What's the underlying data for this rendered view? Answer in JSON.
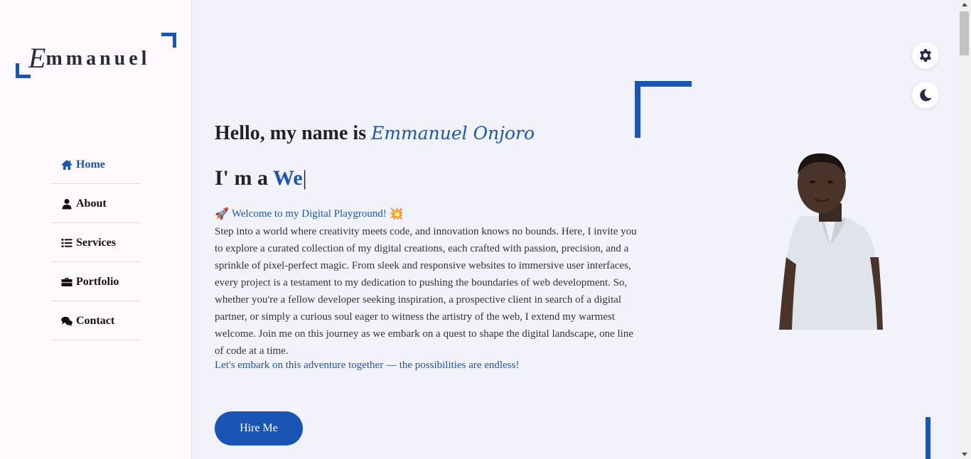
{
  "logo": {
    "first_letter": "E",
    "rest": "mmanuel"
  },
  "nav": {
    "items": [
      {
        "label": "Home",
        "icon": "home-icon",
        "active": true
      },
      {
        "label": "About",
        "icon": "user-icon",
        "active": false
      },
      {
        "label": "Services",
        "icon": "list-icon",
        "active": false
      },
      {
        "label": "Portfolio",
        "icon": "briefcase-icon",
        "active": false
      },
      {
        "label": "Contact",
        "icon": "comments-icon",
        "active": false
      }
    ]
  },
  "hero": {
    "greeting": "Hello, my name is",
    "name": "Emmanuel Onjoro",
    "role_prefix": "I' m a",
    "role_typed": "We",
    "role_cursor": "|",
    "welcome_emoji_start": "🚀",
    "welcome_text": "Welcome to my Digital Playground!",
    "welcome_emoji_end": "💥",
    "paragraph": "Step into a world where creativity meets code, and innovation knows no bounds. Here, I invite you to explore a curated collection of my digital creations, each crafted with passion, precision, and a sprinkle of pixel-perfect magic. From sleek and responsive websites to immersive user interfaces, every project is a testament to my dedication to pushing the boundaries of web development. So, whether you're a fellow developer seeking inspiration, a prospective client in search of a digital partner, or simply a curious soul eager to witness the artistry of the web, I extend my warmest welcome. Join me on this journey as we embark on a quest to shape the digital landscape, one line of code at a time.",
    "tagline": "Let's embark on this adventure together — the possibilities are endless!",
    "hire_label": "Hire Me"
  },
  "controls": {
    "settings_icon": "gear-icon",
    "theme_icon": "moon-icon"
  },
  "colors": {
    "accent": "#1a55b5",
    "sidebar_bg": "#fdf9fd",
    "main_bg": "#f2f2fb"
  }
}
